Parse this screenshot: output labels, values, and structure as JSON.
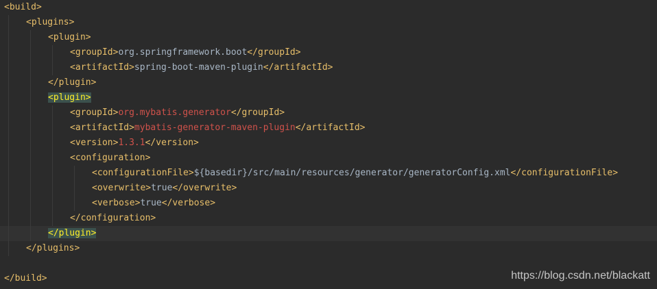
{
  "lines": [
    {
      "indent": 0,
      "parts": [
        {
          "t": "<build>",
          "c": "tag"
        }
      ]
    },
    {
      "indent": 1,
      "parts": [
        {
          "t": "<plugins>",
          "c": "tag"
        }
      ]
    },
    {
      "indent": 2,
      "parts": [
        {
          "t": "<plugin>",
          "c": "tag"
        }
      ]
    },
    {
      "indent": 3,
      "parts": [
        {
          "t": "<groupId>",
          "c": "tag"
        },
        {
          "t": "org.springframework.boot",
          "c": "txt"
        },
        {
          "t": "</groupId>",
          "c": "tag"
        }
      ]
    },
    {
      "indent": 3,
      "parts": [
        {
          "t": "<artifactId>",
          "c": "tag"
        },
        {
          "t": "spring-boot-maven-plugin",
          "c": "txt"
        },
        {
          "t": "</artifactId>",
          "c": "tag"
        }
      ]
    },
    {
      "indent": 2,
      "parts": [
        {
          "t": "</plugin>",
          "c": "tag"
        }
      ]
    },
    {
      "indent": 2,
      "parts": [
        {
          "t": "<plugin>",
          "c": "tag match"
        }
      ]
    },
    {
      "indent": 3,
      "parts": [
        {
          "t": "<groupId>",
          "c": "tag"
        },
        {
          "t": "org.mybatis.generator",
          "c": "red"
        },
        {
          "t": "</groupId>",
          "c": "tag"
        }
      ]
    },
    {
      "indent": 3,
      "parts": [
        {
          "t": "<artifactId>",
          "c": "tag"
        },
        {
          "t": "mybatis-generator-maven-plugin",
          "c": "red"
        },
        {
          "t": "</artifactId>",
          "c": "tag"
        }
      ]
    },
    {
      "indent": 3,
      "parts": [
        {
          "t": "<version>",
          "c": "tag"
        },
        {
          "t": "1.3.1",
          "c": "red"
        },
        {
          "t": "</version>",
          "c": "tag"
        }
      ]
    },
    {
      "indent": 3,
      "parts": [
        {
          "t": "<configuration>",
          "c": "tag"
        }
      ]
    },
    {
      "indent": 4,
      "parts": [
        {
          "t": "<configurationFile>",
          "c": "tag"
        },
        {
          "t": "${basedir}/src/main/resources/generator/generatorConfig.xml",
          "c": "txt"
        },
        {
          "t": "</configurationFile>",
          "c": "tag"
        }
      ]
    },
    {
      "indent": 4,
      "parts": [
        {
          "t": "<overwrite>",
          "c": "tag"
        },
        {
          "t": "true",
          "c": "txt"
        },
        {
          "t": "</overwrite>",
          "c": "tag"
        }
      ]
    },
    {
      "indent": 4,
      "parts": [
        {
          "t": "<verbose>",
          "c": "tag"
        },
        {
          "t": "true",
          "c": "txt"
        },
        {
          "t": "</verbose>",
          "c": "tag"
        }
      ]
    },
    {
      "indent": 3,
      "parts": [
        {
          "t": "</configuration>",
          "c": "tag"
        }
      ]
    },
    {
      "indent": 2,
      "parts": [
        {
          "t": "</plugin>",
          "c": "tag match"
        }
      ],
      "current": true
    },
    {
      "indent": 1,
      "parts": [
        {
          "t": "</plugins>",
          "c": "tag"
        }
      ]
    },
    {
      "indent": 0,
      "parts": []
    },
    {
      "indent": 0,
      "parts": [
        {
          "t": "</build>",
          "c": "tag"
        }
      ]
    }
  ],
  "colors": {
    "background": "#2b2b2b",
    "tag": "#e8bf6a",
    "text": "#a9b7c6",
    "value_red": "#d0524b",
    "match_highlight": "#3b514d",
    "current_line": "#323232"
  },
  "watermark": "https://blog.csdn.net/blackatt"
}
